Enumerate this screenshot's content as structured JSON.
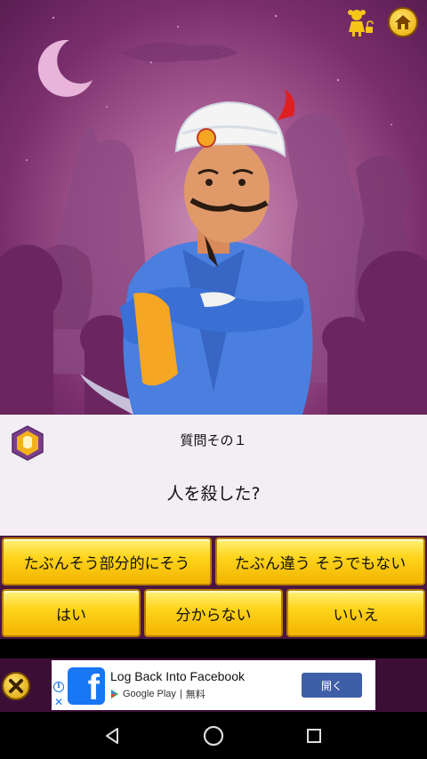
{
  "question": {
    "number_label": "質問その１",
    "text": "人を殺した?"
  },
  "answers": {
    "probably_partially": "たぶんそう部分的にそう",
    "probably_not": "たぶん違う そうでもない",
    "yes": "はい",
    "dont_know": "分からない",
    "no": "いいえ"
  },
  "ad": {
    "title": "Log Back Into Facebook",
    "store": "Google Play",
    "price": "無料",
    "cta": "開く"
  },
  "colors": {
    "button_yellow": "#ffd51c",
    "scene_purple": "#7a2f6c",
    "panel_bg": "#f2eef4",
    "ad_blue": "#3f5ea8"
  },
  "icons": [
    "girl-icon",
    "unlock-icon",
    "home-icon",
    "badge-icon",
    "close-icon",
    "facebook-icon",
    "back-icon",
    "home-nav-icon",
    "recents-icon"
  ]
}
